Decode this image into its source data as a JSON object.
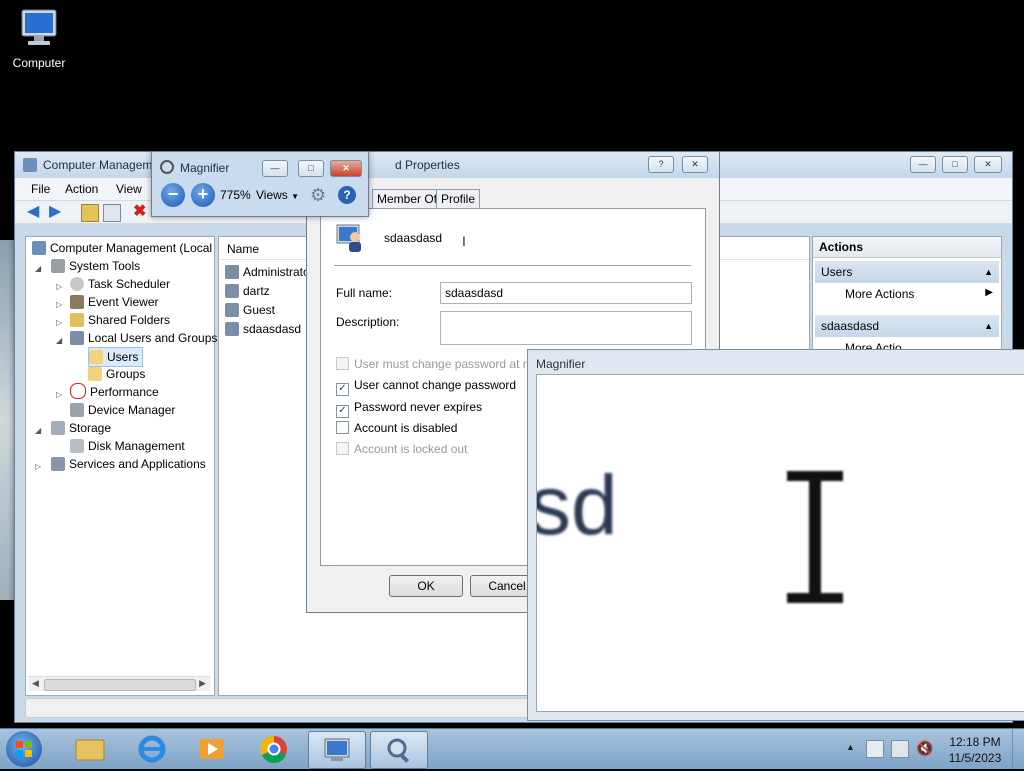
{
  "desktop": {
    "icon_label": "Computer"
  },
  "computer_management": {
    "title": "Computer Management",
    "menu": [
      "File",
      "Action",
      "View"
    ],
    "tree": [
      {
        "label": "Computer Management (Local"
      },
      {
        "label": "System Tools"
      },
      {
        "label": "Task Scheduler"
      },
      {
        "label": "Event Viewer"
      },
      {
        "label": "Shared Folders"
      },
      {
        "label": "Local Users and Groups"
      },
      {
        "label": "Users"
      },
      {
        "label": "Groups"
      },
      {
        "label": "Performance"
      },
      {
        "label": "Device Manager"
      },
      {
        "label": "Storage"
      },
      {
        "label": "Disk Management"
      },
      {
        "label": "Services and Applications"
      }
    ],
    "list_header": "Name",
    "list_items": [
      "Administrato",
      "dartz",
      "Guest",
      "sdaasdasd"
    ],
    "actions": {
      "header": "Actions",
      "group1": "Users",
      "group1_item": "More Actions",
      "group2": "sdaasdasd",
      "group2_item": "More Actio"
    }
  },
  "properties": {
    "title": "d Properties",
    "tabs": [
      "Member Of",
      "Profile"
    ],
    "username": "sdaasdasd",
    "full_name_label": "Full name:",
    "full_name_value": "sdaasdasd",
    "description_label": "Description:",
    "description_value": "",
    "checkboxes": [
      {
        "label": "User must change password at next lo",
        "checked": false,
        "disabled": true
      },
      {
        "label": "User cannot change password",
        "checked": true,
        "disabled": false
      },
      {
        "label": "Password never expires",
        "checked": true,
        "disabled": false
      },
      {
        "label": "Account is disabled",
        "checked": false,
        "disabled": false
      },
      {
        "label": "Account is locked out",
        "checked": false,
        "disabled": true
      }
    ],
    "ok_label": "OK",
    "cancel_label": "Cancel"
  },
  "magnifier_toolbar": {
    "title": "Magnifier",
    "zoom": "775%",
    "views_label": "Views"
  },
  "magnifier_lens": {
    "title": "Magnifier",
    "magnified_text": "sd"
  },
  "taskbar": {
    "time": "12:18 PM",
    "date": "11/5/2023"
  }
}
